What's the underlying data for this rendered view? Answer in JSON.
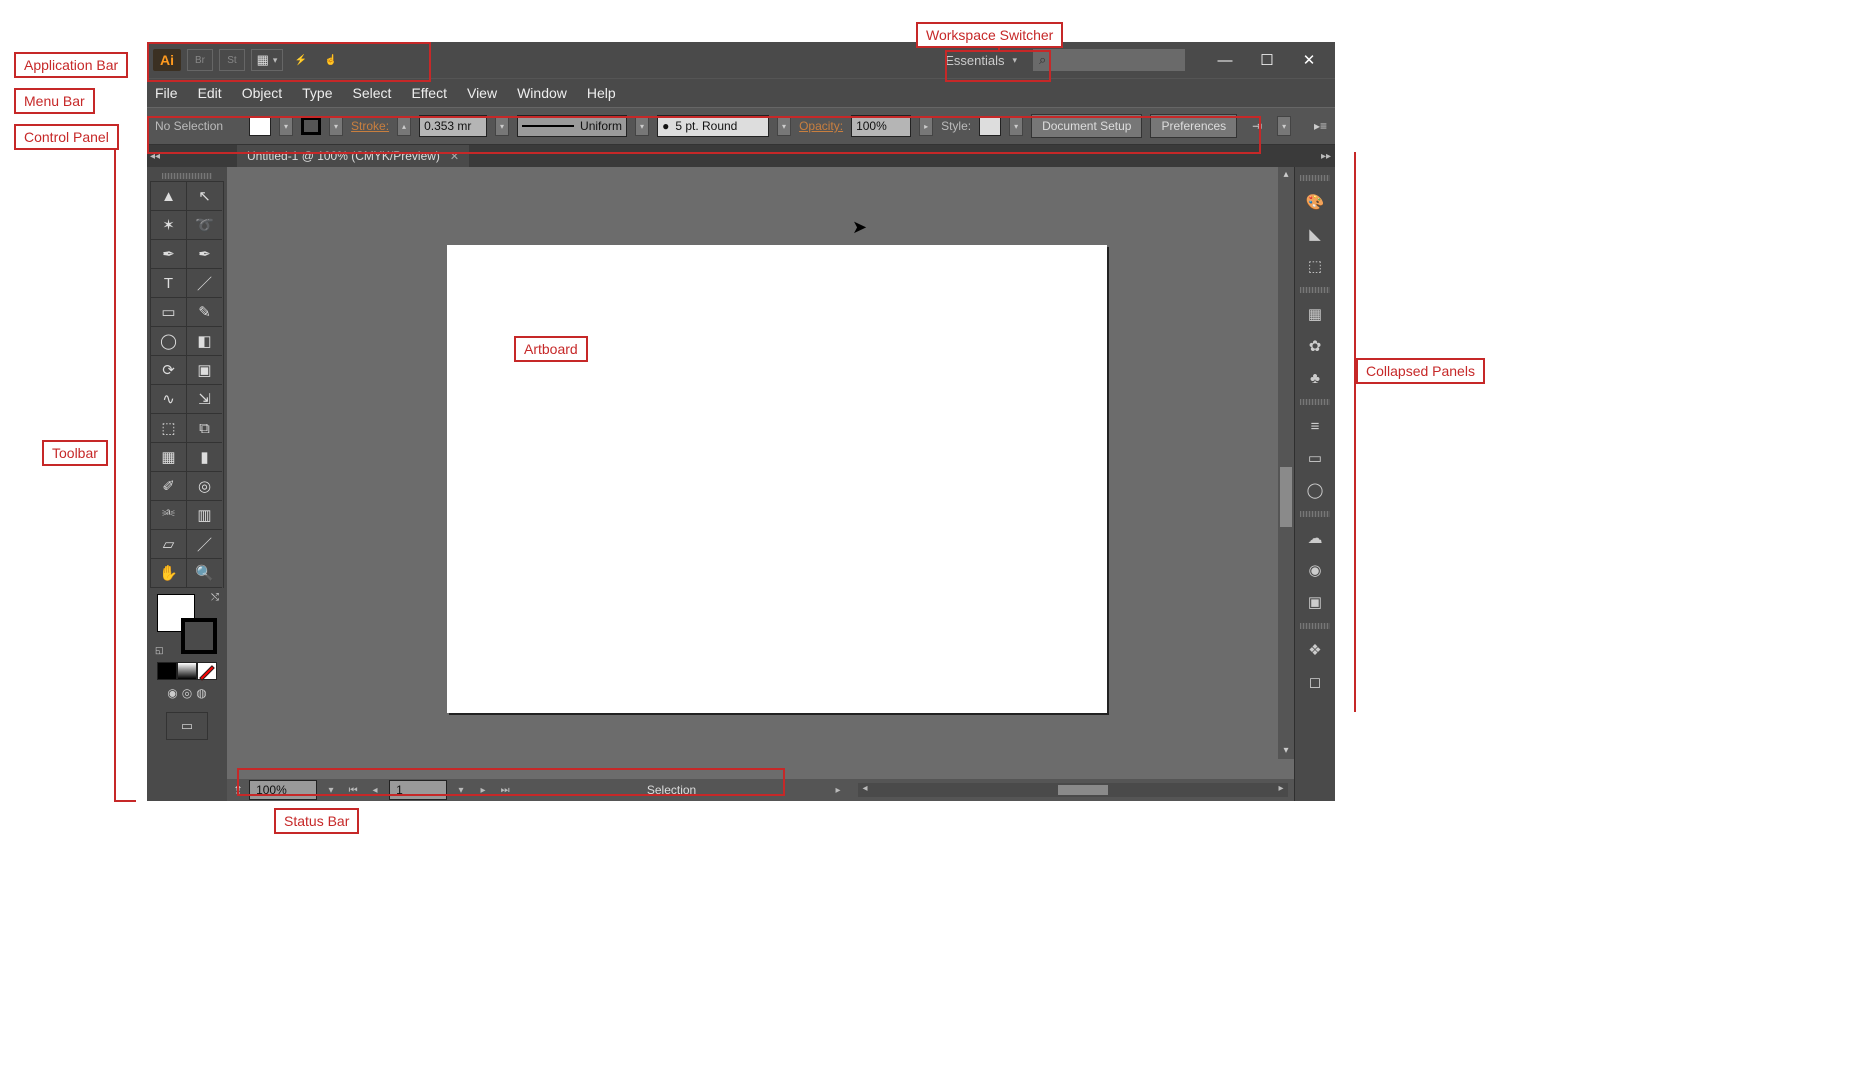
{
  "callouts": {
    "application_bar": "Application Bar",
    "menu_bar": "Menu Bar",
    "control_panel": "Control Panel",
    "toolbar": "Toolbar",
    "workspace_switcher": "Workspace Switcher",
    "artboard": "Artboard",
    "collapsed_panels": "Collapsed Panels",
    "status_bar": "Status Bar"
  },
  "app_bar": {
    "logo": "Ai",
    "br": "Br",
    "st": "St",
    "workspace": "Essentials"
  },
  "menu": [
    "File",
    "Edit",
    "Object",
    "Type",
    "Select",
    "Effect",
    "View",
    "Window",
    "Help"
  ],
  "control_panel": {
    "selection": "No Selection",
    "stroke_label": "Stroke:",
    "stroke_value": "0.353 mr",
    "profile": "Uniform",
    "brush": "5 pt. Round",
    "opacity_label": "Opacity:",
    "opacity_value": "100%",
    "style_label": "Style:",
    "doc_setup": "Document Setup",
    "preferences": "Preferences"
  },
  "document_tab": "Untitled-1 @ 100% (CMYK/Preview)",
  "status": {
    "zoom": "100%",
    "artboard_nav": "1",
    "tool": "Selection"
  },
  "tools": [
    "selection",
    "direct-selection",
    "magic-wand",
    "lasso",
    "pen",
    "curvature",
    "type",
    "line",
    "rectangle",
    "paintbrush",
    "shaper",
    "eraser",
    "rotate",
    "scale",
    "width",
    "free-transform",
    "shape-builder",
    "perspective",
    "mesh",
    "gradient",
    "eyedropper",
    "blend",
    "symbol-sprayer",
    "column-graph",
    "artboard",
    "slice",
    "hand",
    "zoom"
  ],
  "tool_glyphs": [
    "▲",
    "↖",
    "✶",
    "➰",
    "✒",
    "✒",
    "T",
    "／",
    "▭",
    "✎",
    "◯",
    "◧",
    "⟳",
    "▣",
    "∿",
    "⇲",
    "⬚",
    "⧉",
    "▦",
    "▮",
    "✐",
    "◎",
    "⎃",
    "▥",
    "▱",
    "／",
    "✋",
    "🔍"
  ],
  "panels": [
    "color",
    "color-guide",
    "swatches",
    "brushes",
    "symbols",
    "stroke",
    "gradient",
    "transparency",
    "appearance",
    "graphic-styles",
    "layers",
    "artboards"
  ],
  "panel_glyphs": [
    "🎨",
    "◣",
    "⬚",
    "▦",
    "✿",
    "♣",
    "≡",
    "▭",
    "◯",
    "☁",
    "◉",
    "▣",
    "❖",
    "◻"
  ]
}
